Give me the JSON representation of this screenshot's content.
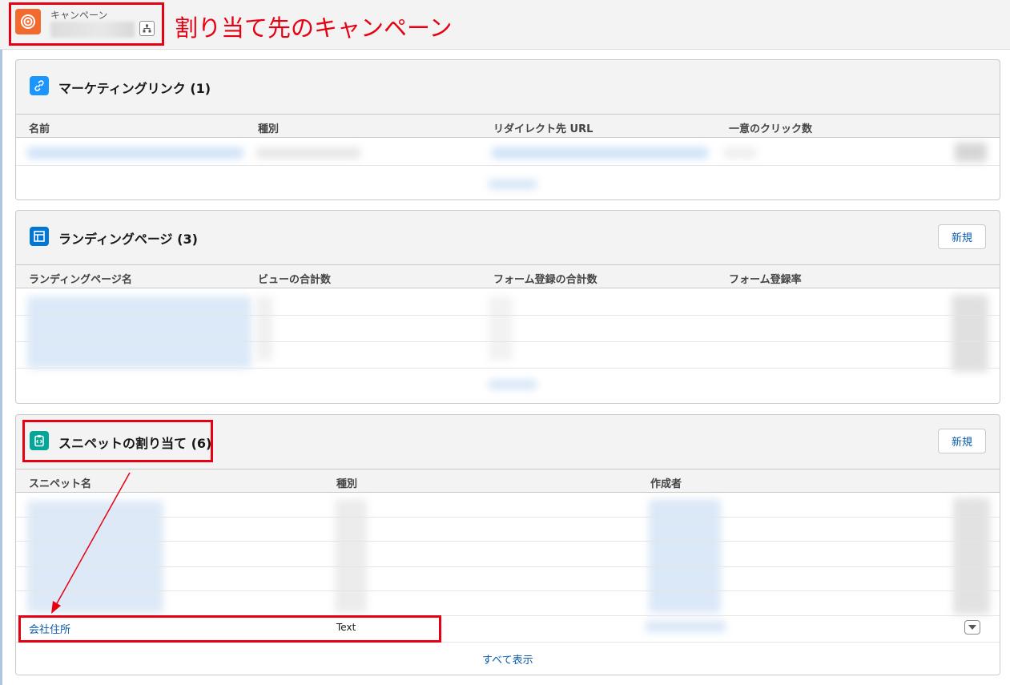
{
  "header": {
    "record_type": "キャンペーン",
    "annotation": "割り当て先のキャンペーン"
  },
  "marketing_links": {
    "title": "マーケティングリンク",
    "count": "(1)",
    "columns": [
      "名前",
      "種別",
      "リダイレクト先 URL",
      "一意のクリック数"
    ]
  },
  "landing_pages": {
    "title": "ランディングページ",
    "count": "(3)",
    "new_label": "新規",
    "columns": [
      "ランディングページ名",
      "ビューの合計数",
      "フォーム登録の合計数",
      "フォーム登録率"
    ]
  },
  "snippets": {
    "title": "スニペットの割り当て",
    "count": "(6)",
    "new_label": "新規",
    "columns": [
      "スニペット名",
      "種別",
      "作成者"
    ],
    "highlight_row": {
      "name": "会社住所",
      "type": "Text"
    },
    "view_all": "すべて表示"
  },
  "colors": {
    "annotation_red": "#e60012",
    "link_blue": "#0b5cab",
    "campaign_orange": "#f26a2e"
  }
}
